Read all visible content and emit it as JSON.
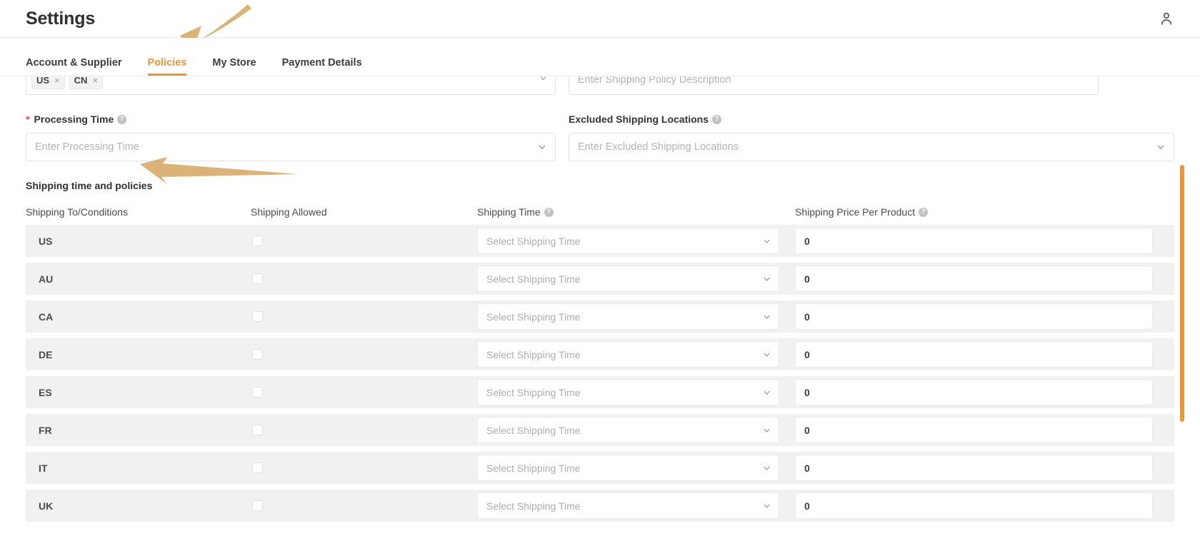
{
  "header": {
    "title": "Settings",
    "user_icon": "user-icon"
  },
  "tabs": [
    {
      "label": "Account & Supplier",
      "active": false
    },
    {
      "label": "Policies",
      "active": true
    },
    {
      "label": "My Store",
      "active": false
    },
    {
      "label": "Payment Details",
      "active": false
    }
  ],
  "form": {
    "shipping_locations_chips": [
      {
        "label": "US",
        "remove": "×"
      },
      {
        "label": "CN",
        "remove": "×"
      }
    ],
    "policy_description_placeholder": "Enter Shipping Policy Description",
    "processing_time": {
      "label": "Processing Time",
      "required": true,
      "required_marker": "*",
      "help": "?",
      "placeholder": "Enter Processing Time"
    },
    "excluded_locations": {
      "label": "Excluded Shipping Locations",
      "required": false,
      "help": "?",
      "placeholder": "Enter Excluded Shipping Locations"
    }
  },
  "section": {
    "title": "Shipping time and policies"
  },
  "table": {
    "columns": [
      {
        "label": "Shipping To/Conditions",
        "help": false
      },
      {
        "label": "Shipping Allowed",
        "help": false
      },
      {
        "label": "Shipping Time",
        "help": true,
        "help_glyph": "?"
      },
      {
        "label": "Shipping Price Per Product",
        "help": true,
        "help_glyph": "?"
      }
    ],
    "shipping_time_placeholder": "Select Shipping Time",
    "rows": [
      {
        "code": "US",
        "allowed": false,
        "shipping_time": "",
        "price": "0"
      },
      {
        "code": "AU",
        "allowed": false,
        "shipping_time": "",
        "price": "0"
      },
      {
        "code": "CA",
        "allowed": false,
        "shipping_time": "",
        "price": "0"
      },
      {
        "code": "DE",
        "allowed": false,
        "shipping_time": "",
        "price": "0"
      },
      {
        "code": "ES",
        "allowed": false,
        "shipping_time": "",
        "price": "0"
      },
      {
        "code": "FR",
        "allowed": false,
        "shipping_time": "",
        "price": "0"
      },
      {
        "code": "IT",
        "allowed": false,
        "shipping_time": "",
        "price": "0"
      },
      {
        "code": "UK",
        "allowed": false,
        "shipping_time": "",
        "price": "0"
      }
    ]
  },
  "annotations": [
    {
      "name": "arrow-to-policies-tab",
      "color": "#dbb378"
    },
    {
      "name": "arrow-to-shipping-section",
      "color": "#dbb378"
    }
  ],
  "colors": {
    "accent": "#e8973c",
    "row_bg": "#f1f1f1",
    "text": "#3c3c3c",
    "placeholder": "#b3b3b3",
    "arrow": "#dbb378",
    "scrollbar": "#e8973c"
  }
}
